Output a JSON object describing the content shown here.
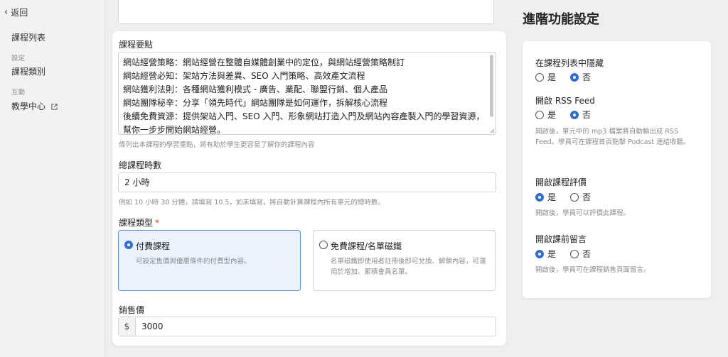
{
  "sidebar": {
    "back_label": "返回",
    "items": [
      {
        "label": "課程列表"
      },
      {
        "group": "設定"
      },
      {
        "label": "課程類別"
      },
      {
        "group": "互動"
      },
      {
        "label": "教學中心"
      }
    ]
  },
  "main": {
    "key_points": {
      "label": "課程要點",
      "lines": [
        "網站經營策略：網站經營在整體自媒體創業中的定位，與網站經營策略制訂",
        "網站經營必知：架站方法與差異、SEO 入門策略、高效產文流程",
        "網站獲利法則：各種網站獲利模式 - 廣告、業配、聯盟行銷、個人產品",
        "網站團隊秘辛：分享「領先時代」網站團隊是如何運作，拆解核心流程",
        "後續免費資源：提供架站入門、SEO 入門、形象網站打造入門及網站內容產製入門的學習資源，",
        "幫你一步步開始網站經營。"
      ],
      "hint": "條列出本課程的學習重點，將有助於學生更容易了解你的課程內容"
    },
    "duration": {
      "label": "總課程時數",
      "value": "2 小時",
      "hint": "例如 10 小時 30 分鐘，請填寫 10.5，如未填寫，將自動計算課程內所有單元的總時數。"
    },
    "course_type": {
      "label": "課程類型",
      "required_mark": "*",
      "options": [
        {
          "title": "付費課程",
          "desc": "可設定售價與優惠條件的付費型內容。",
          "selected": true
        },
        {
          "title": "免費課程/名單磁鐵",
          "desc": "名單磁鐵即使用者註冊後即可兌換、解鎖內容，可運用於增加、累積會員名單。",
          "selected": false
        }
      ]
    },
    "price": {
      "label": "銷售價",
      "prefix": "$",
      "value": "3000"
    }
  },
  "advanced": {
    "title": "進階功能設定",
    "settings": [
      {
        "label": "在課程列表中隱藏",
        "yes": "是",
        "no": "否",
        "selected": "no",
        "hint": ""
      },
      {
        "label": "開啟 RSS Feed",
        "yes": "是",
        "no": "否",
        "selected": "no",
        "hint": "開啟後，單元中的 mp3 檔案將自動輸出成 RSS Feed。學員可在課程首頁點擊 Podcast 連結收聽。"
      },
      {
        "label": "開啟課程評價",
        "yes": "是",
        "no": "否",
        "selected": "yes",
        "hint": "開啟後，學員可以評價此課程。"
      },
      {
        "label": "開啟課前留言",
        "yes": "是",
        "no": "否",
        "selected": "yes",
        "hint": "開啟後，學員可在課程銷售頁面留言。"
      }
    ]
  },
  "colors": {
    "accent": "#2f6ce0",
    "selected_bg": "#eaf2fe",
    "required": "#e03a3a"
  }
}
